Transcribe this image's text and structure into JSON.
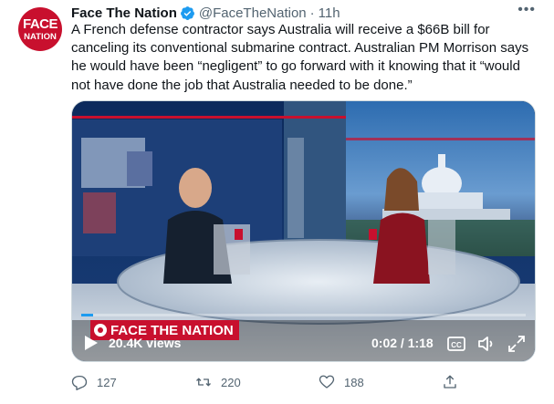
{
  "account": {
    "avatar_line1": "FACE",
    "avatar_line2": "NATION",
    "name": "Face The Nation",
    "handle": "@FaceTheNation",
    "separator": "·",
    "time": "11h"
  },
  "more_menu": "•••",
  "tweet_text": "A French defense contractor says Australia will receive a $66B bill for canceling its conventional submarine contract. Australian PM Morrison says he would have been “negligent” to go forward with it knowing that it “would not have done the job that Australia needed to be done.”",
  "video": {
    "overlay_logo": "FACE THE NATION",
    "views": "20.4K views",
    "time": "0:02 / 1:18",
    "progress": 0.026
  },
  "actions": {
    "replies": "127",
    "retweets": "220",
    "likes": "188"
  },
  "colors": {
    "brand_red": "#c8102e",
    "verified_blue": "#1d9bf0",
    "muted_text": "#536471"
  }
}
